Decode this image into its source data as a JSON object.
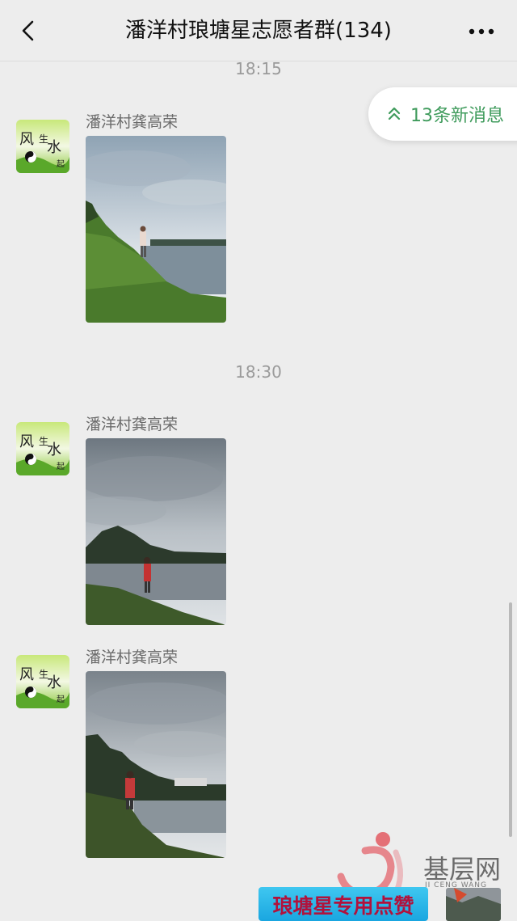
{
  "header": {
    "title": "潘洋村琅塘星志愿者群(134)",
    "back_icon": "chevron-left-icon",
    "more_icon": "more-dots-icon"
  },
  "new_messages": {
    "label": "13条新消息",
    "icon": "double-chevron-up-icon",
    "color": "#3f9b5c"
  },
  "timestamps": [
    "18:15",
    "18:30"
  ],
  "messages": [
    {
      "sender": "潘洋村龚高荣",
      "type": "image",
      "avatar_icon": "avatar-image"
    },
    {
      "sender": "潘洋村龚高荣",
      "type": "image",
      "avatar_icon": "avatar-image"
    },
    {
      "sender": "潘洋村龚高荣",
      "type": "image",
      "avatar_icon": "avatar-image"
    }
  ],
  "sticker": {
    "text": "琅塘星专用点赞"
  },
  "watermark": {
    "text": "基层网",
    "sub": "JI CENG WANG"
  }
}
